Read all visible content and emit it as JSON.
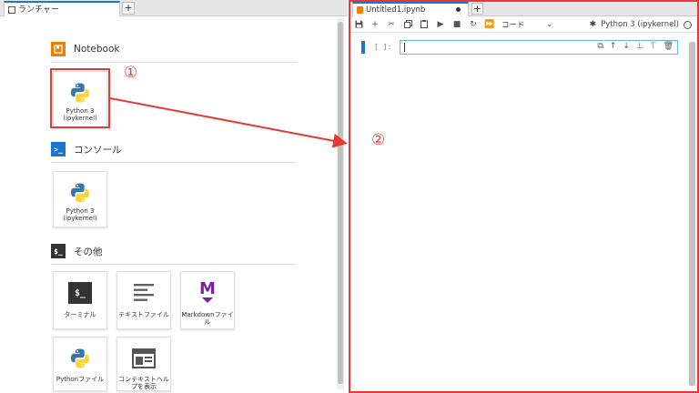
{
  "left_pane": {
    "tab": {
      "icon": "launcher-icon",
      "label": "ランチャー"
    },
    "new_tab_label": "+",
    "sections": {
      "notebook": {
        "title": "Notebook",
        "icon": "notebook-section-icon",
        "color": "#f57c00"
      },
      "console": {
        "title": "コンソール",
        "icon": "console-section-icon",
        "glyph": ">_",
        "color": "#1976d2"
      },
      "other": {
        "title": "その他",
        "icon": "other-section-icon",
        "glyph": "$_",
        "color": "#333333"
      }
    },
    "cards": {
      "notebook_python": {
        "label": "Python 3 (ipykernel)",
        "icon": "python-logo-icon"
      },
      "console_python": {
        "label": "Python 3 (ipykernel)",
        "icon": "python-logo-icon"
      },
      "terminal": {
        "label": "ターミナル",
        "icon": "terminal-icon",
        "glyph": "$_"
      },
      "text_file": {
        "label": "テキストファイル",
        "icon": "text-file-icon"
      },
      "markdown_file": {
        "label": "Markdownファイル",
        "icon": "markdown-icon",
        "glyph": "M"
      },
      "python_file": {
        "label": "Pythonファイル",
        "icon": "python-logo-icon"
      },
      "context_help": {
        "label": "コンテキストヘルプを表示",
        "icon": "context-help-icon"
      }
    }
  },
  "annotations": {
    "marker_1": "①",
    "marker_2": "②",
    "color": "#e53935"
  },
  "right_pane": {
    "tab": {
      "label": "Untitled1.ipynb",
      "dirty_indicator": "●"
    },
    "new_tab_label": "+",
    "toolbar": {
      "buttons": [
        "save-icon",
        "add-cell-icon",
        "cut-icon",
        "copy-icon",
        "paste-icon",
        "run-icon",
        "stop-icon",
        "restart-icon",
        "run-all-icon"
      ],
      "cell_type": "コード",
      "kernel_name": "Python 3 (ipykernel)"
    },
    "cell": {
      "prompt": "[ ]:",
      "content": ""
    }
  }
}
